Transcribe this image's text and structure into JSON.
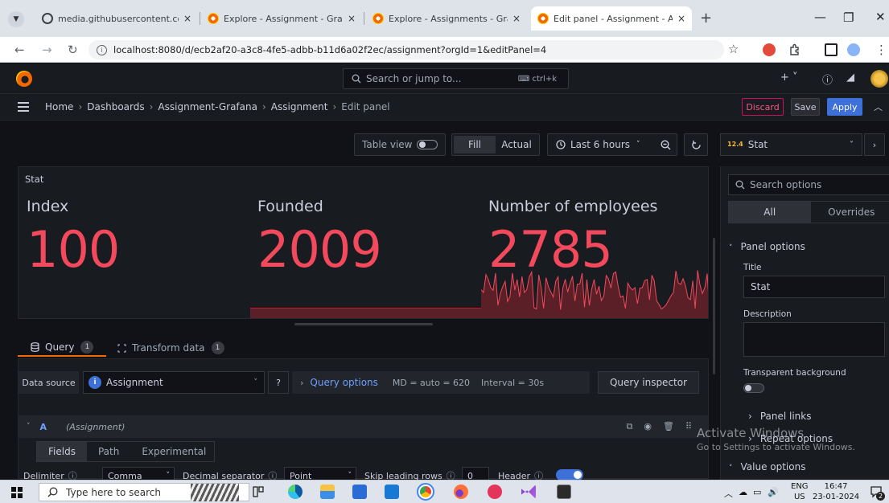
{
  "browser": {
    "tabs": [
      {
        "title": "media.githubusercontent.com/",
        "icon": "github-icon",
        "active": false
      },
      {
        "title": "Explore - Assignment - Grafana",
        "icon": "grafana-icon",
        "active": false
      },
      {
        "title": "Explore - Assignments - Grafan",
        "icon": "grafana-icon",
        "active": false
      },
      {
        "title": "Edit panel - Assignment - Assig",
        "icon": "grafana-icon",
        "active": true
      }
    ],
    "close_glyph": "×",
    "new_tab_glyph": "+",
    "url": "localhost:8080/d/ecb2af20-a3c8-4fe5-adbb-b11d6a02f2ec/assignment?orgId=1&editPanel=4"
  },
  "grafana": {
    "search_placeholder": "Search or jump to...",
    "search_shortcut": "ctrl+k",
    "plus_label": "+ ˅",
    "breadcrumb": [
      "Home",
      "Dashboards",
      "Assignment-Grafana",
      "Assignment",
      "Edit panel"
    ],
    "actions": {
      "discard": "Discard",
      "save": "Save",
      "apply": "Apply"
    }
  },
  "toolbar": {
    "table_view": "Table view",
    "fill": "Fill",
    "actual": "Actual",
    "time_range": "Last 6 hours"
  },
  "viz": {
    "badge": "12.4",
    "name": "Stat"
  },
  "panel": {
    "title": "Stat",
    "stats": [
      {
        "label": "Index",
        "value": "100"
      },
      {
        "label": "Founded",
        "value": "2009"
      },
      {
        "label": "Number of employees",
        "value": "2785"
      }
    ],
    "value_color": "#f2495c"
  },
  "query_tabs": [
    {
      "label": "Query",
      "count": "1"
    },
    {
      "label": "Transform data",
      "count": "1"
    }
  ],
  "query": {
    "data_source_label": "Data source",
    "data_source": "Assignment",
    "query_options": "Query options",
    "md": "MD = auto = 620",
    "interval": "Interval = 30s",
    "inspector": "Query inspector",
    "ref_id": "A",
    "ds_name": "(Assignment)",
    "subtabs": [
      "Fields",
      "Path",
      "Experimental"
    ],
    "fields": {
      "delimiter_label": "Delimiter",
      "delimiter_value": "Comma",
      "decimal_label": "Decimal separator",
      "decimal_value": "Point",
      "skip_label": "Skip leading rows",
      "skip_value": "0",
      "header_label": "Header"
    }
  },
  "options": {
    "search_placeholder": "Search options",
    "tabs": [
      "All",
      "Overrides"
    ],
    "panel_options": "Panel options",
    "title_label": "Title",
    "title_value": "Stat",
    "description_label": "Description",
    "transparent_label": "Transparent background",
    "panel_links": "Panel links",
    "repeat_options": "Repeat options",
    "value_options": "Value options"
  },
  "watermark": {
    "title": "Activate Windows",
    "subtitle": "Go to Settings to activate Windows."
  },
  "taskbar": {
    "search_placeholder": "Type here to search",
    "lang_top": "ENG",
    "lang_bottom": "US",
    "time": "16:47",
    "date": "23-01-2024",
    "notif_count": "2"
  }
}
